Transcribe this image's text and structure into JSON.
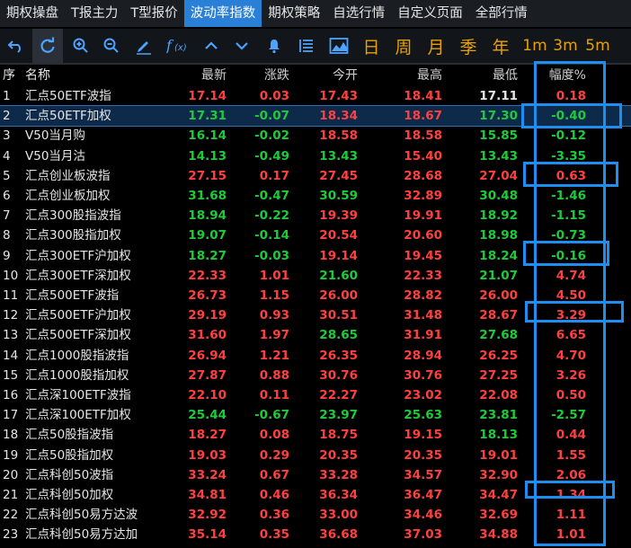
{
  "tabs": [
    "期权操盘",
    "T报主力",
    "T型报价",
    "波动率指数",
    "期权策略",
    "自选行情",
    "自定义页面",
    "全部行情"
  ],
  "active_tab": 3,
  "toolbar_text": [
    "日",
    "周",
    "月",
    "季",
    "年",
    "1m",
    "3m",
    "5m"
  ],
  "columns": {
    "idx": "序",
    "name": "名称",
    "last": "最新",
    "chg": "涨跌",
    "open": "今开",
    "high": "最高",
    "low": "最低",
    "amp": "幅度%"
  },
  "colors": {
    "red": "#ff4040",
    "green": "#1ecb3a",
    "white": "#e6e6e6",
    "accent": "#2a7fd6"
  },
  "rows": [
    {
      "idx": "1",
      "name": "汇点50ETF波指",
      "last": "17.14",
      "chg": "0.03",
      "open": "17.43",
      "high": "18.41",
      "low": "17.11",
      "amp": "0.18",
      "c": [
        "r",
        "r",
        "r",
        "r",
        "w",
        "r"
      ]
    },
    {
      "idx": "2",
      "name": "汇点50ETF加权",
      "last": "17.31",
      "chg": "-0.07",
      "open": "18.34",
      "high": "18.67",
      "low": "17.30",
      "amp": "-0.40",
      "c": [
        "g",
        "g",
        "r",
        "r",
        "g",
        "g"
      ]
    },
    {
      "idx": "3",
      "name": "V50当月购",
      "last": "16.14",
      "chg": "-0.02",
      "open": "18.58",
      "high": "18.58",
      "low": "15.85",
      "amp": "-0.12",
      "c": [
        "g",
        "g",
        "r",
        "r",
        "g",
        "g"
      ]
    },
    {
      "idx": "4",
      "name": "V50当月沽",
      "last": "14.13",
      "chg": "-0.49",
      "open": "13.43",
      "high": "15.40",
      "low": "13.43",
      "amp": "-3.35",
      "c": [
        "g",
        "g",
        "g",
        "r",
        "g",
        "g"
      ]
    },
    {
      "idx": "5",
      "name": "汇点创业板波指",
      "last": "27.15",
      "chg": "0.17",
      "open": "27.45",
      "high": "28.68",
      "low": "27.04",
      "amp": "0.63",
      "c": [
        "r",
        "r",
        "r",
        "r",
        "r",
        "r"
      ]
    },
    {
      "idx": "6",
      "name": "汇点创业板加权",
      "last": "31.68",
      "chg": "-0.47",
      "open": "30.59",
      "high": "32.89",
      "low": "30.48",
      "amp": "-1.46",
      "c": [
        "g",
        "g",
        "g",
        "r",
        "g",
        "g"
      ]
    },
    {
      "idx": "7",
      "name": "汇点300股指波指",
      "last": "18.94",
      "chg": "-0.22",
      "open": "19.39",
      "high": "19.91",
      "low": "18.92",
      "amp": "-1.15",
      "c": [
        "g",
        "g",
        "r",
        "r",
        "g",
        "g"
      ]
    },
    {
      "idx": "8",
      "name": "汇点300股指加权",
      "last": "19.07",
      "chg": "-0.14",
      "open": "20.54",
      "high": "20.60",
      "low": "18.98",
      "amp": "-0.73",
      "c": [
        "g",
        "g",
        "r",
        "r",
        "g",
        "g"
      ]
    },
    {
      "idx": "9",
      "name": "汇点300ETF沪加权",
      "last": "18.27",
      "chg": "-0.03",
      "open": "19.14",
      "high": "19.45",
      "low": "18.24",
      "amp": "-0.16",
      "c": [
        "g",
        "g",
        "r",
        "r",
        "g",
        "g"
      ]
    },
    {
      "idx": "10",
      "name": "汇点300ETF深加权",
      "last": "22.33",
      "chg": "1.01",
      "open": "21.60",
      "high": "22.33",
      "low": "21.07",
      "amp": "4.74",
      "c": [
        "r",
        "r",
        "g",
        "r",
        "g",
        "r"
      ]
    },
    {
      "idx": "11",
      "name": "汇点500ETF波指",
      "last": "26.73",
      "chg": "1.15",
      "open": "26.00",
      "high": "28.82",
      "low": "26.00",
      "amp": "4.50",
      "c": [
        "r",
        "r",
        "r",
        "r",
        "r",
        "r"
      ]
    },
    {
      "idx": "12",
      "name": "汇点500ETF沪加权",
      "last": "29.19",
      "chg": "0.93",
      "open": "30.51",
      "high": "31.48",
      "low": "28.67",
      "amp": "3.29",
      "c": [
        "r",
        "r",
        "r",
        "r",
        "r",
        "r"
      ]
    },
    {
      "idx": "13",
      "name": "汇点500ETF深加权",
      "last": "31.60",
      "chg": "1.97",
      "open": "28.65",
      "high": "31.91",
      "low": "27.68",
      "amp": "6.65",
      "c": [
        "r",
        "r",
        "g",
        "r",
        "g",
        "r"
      ]
    },
    {
      "idx": "14",
      "name": "汇点1000股指波指",
      "last": "26.94",
      "chg": "1.21",
      "open": "26.35",
      "high": "28.94",
      "low": "26.25",
      "amp": "4.70",
      "c": [
        "r",
        "r",
        "r",
        "r",
        "r",
        "r"
      ]
    },
    {
      "idx": "15",
      "name": "汇点1000股指加权",
      "last": "27.87",
      "chg": "0.88",
      "open": "30.76",
      "high": "30.76",
      "low": "27.25",
      "amp": "3.26",
      "c": [
        "r",
        "r",
        "r",
        "r",
        "r",
        "r"
      ]
    },
    {
      "idx": "16",
      "name": "汇点深100ETF波指",
      "last": "22.10",
      "chg": "0.11",
      "open": "22.27",
      "high": "23.02",
      "low": "22.08",
      "amp": "0.50",
      "c": [
        "r",
        "r",
        "r",
        "r",
        "r",
        "r"
      ]
    },
    {
      "idx": "17",
      "name": "汇点深100ETF加权",
      "last": "25.44",
      "chg": "-0.67",
      "open": "23.97",
      "high": "25.63",
      "low": "23.81",
      "amp": "-2.57",
      "c": [
        "g",
        "g",
        "g",
        "g",
        "g",
        "g"
      ]
    },
    {
      "idx": "18",
      "name": "汇点50股指波指",
      "last": "18.27",
      "chg": "0.08",
      "open": "18.75",
      "high": "19.15",
      "low": "18.13",
      "amp": "0.44",
      "c": [
        "r",
        "r",
        "r",
        "r",
        "g",
        "r"
      ]
    },
    {
      "idx": "19",
      "name": "汇点50股指加权",
      "last": "19.03",
      "chg": "0.29",
      "open": "20.35",
      "high": "20.35",
      "low": "19.01",
      "amp": "1.55",
      "c": [
        "r",
        "r",
        "r",
        "r",
        "r",
        "r"
      ]
    },
    {
      "idx": "20",
      "name": "汇点科创50波指",
      "last": "33.24",
      "chg": "0.67",
      "open": "33.28",
      "high": "34.57",
      "low": "32.90",
      "amp": "2.06",
      "c": [
        "r",
        "r",
        "r",
        "r",
        "r",
        "r"
      ]
    },
    {
      "idx": "21",
      "name": "汇点科创50加权",
      "last": "34.81",
      "chg": "0.46",
      "open": "36.34",
      "high": "36.47",
      "low": "34.47",
      "amp": "1.34",
      "c": [
        "r",
        "r",
        "r",
        "r",
        "r",
        "r"
      ]
    },
    {
      "idx": "22",
      "name": "汇点科创50易方达波",
      "last": "32.92",
      "chg": "0.36",
      "open": "33.00",
      "high": "34.46",
      "low": "32.69",
      "amp": "1.11",
      "c": [
        "r",
        "r",
        "r",
        "r",
        "r",
        "r"
      ]
    },
    {
      "idx": "23",
      "name": "汇点科创50易方达加",
      "last": "35.14",
      "chg": "0.35",
      "open": "36.68",
      "high": "37.03",
      "low": "34.88",
      "amp": "1.01",
      "c": [
        "r",
        "r",
        "r",
        "r",
        "r",
        "r"
      ]
    }
  ],
  "selected_row": 1
}
